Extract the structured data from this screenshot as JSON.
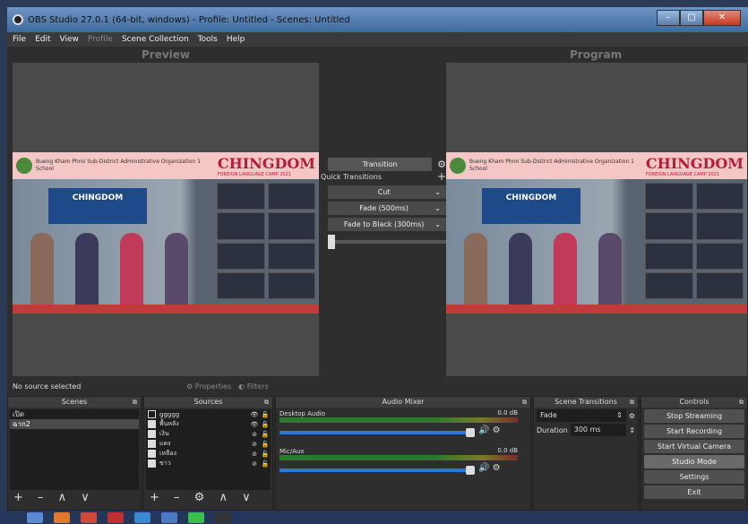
{
  "window": {
    "title": "OBS Studio 27.0.1 (64-bit, windows) - Profile: Untitled - Scenes: Untitled",
    "minimize": "–",
    "maximize": "□",
    "close": "✕"
  },
  "menu": {
    "file": "File",
    "edit": "Edit",
    "view": "View",
    "profile": "Profile",
    "scene_collection": "Scene Collection",
    "tools": "Tools",
    "help": "Help"
  },
  "preview": {
    "label": "Preview"
  },
  "program": {
    "label": "Program"
  },
  "scene_content": {
    "school": "Bueng Kham Phroi Sub-District\nAdministrative Organization 1 School",
    "brand": "CHINGDOM",
    "camp": "FOREIGN LANGUAGE CAMP 2021",
    "stage": "CHINGDOM"
  },
  "transitions": {
    "button": "Transition",
    "quick_label": "Quick Transitions",
    "add": "+",
    "items": [
      "Cut",
      "Fade (500ms)",
      "Fade to Black (300ms)"
    ]
  },
  "status": {
    "no_source": "No source selected",
    "properties": "Properties",
    "filters": "Filters"
  },
  "scenes": {
    "title": "Scenes",
    "items": [
      "เปิด",
      "ฉาก2"
    ],
    "footer": "+ – ∧ ∨"
  },
  "sources": {
    "title": "Sources",
    "items": [
      "ggggg",
      "พื้นหลัง",
      "เงิน",
      "แดง",
      "เหลือง",
      "ขาว"
    ],
    "footer": "+ – ⚙ ∧ ∨"
  },
  "mixer": {
    "title": "Audio Mixer",
    "channels": [
      {
        "name": "Desktop Audio",
        "db": "0.0 dB"
      },
      {
        "name": "Mic/Aux",
        "db": "0.0 dB"
      }
    ]
  },
  "scene_transitions": {
    "title": "Scene Transitions",
    "type": "Fade",
    "duration_label": "Duration",
    "duration_value": "300 ms"
  },
  "controls": {
    "title": "Controls",
    "buttons": [
      "Stop Streaming",
      "Start Recording",
      "Start Virtual Camera",
      "Studio Mode",
      "Settings",
      "Exit"
    ]
  }
}
